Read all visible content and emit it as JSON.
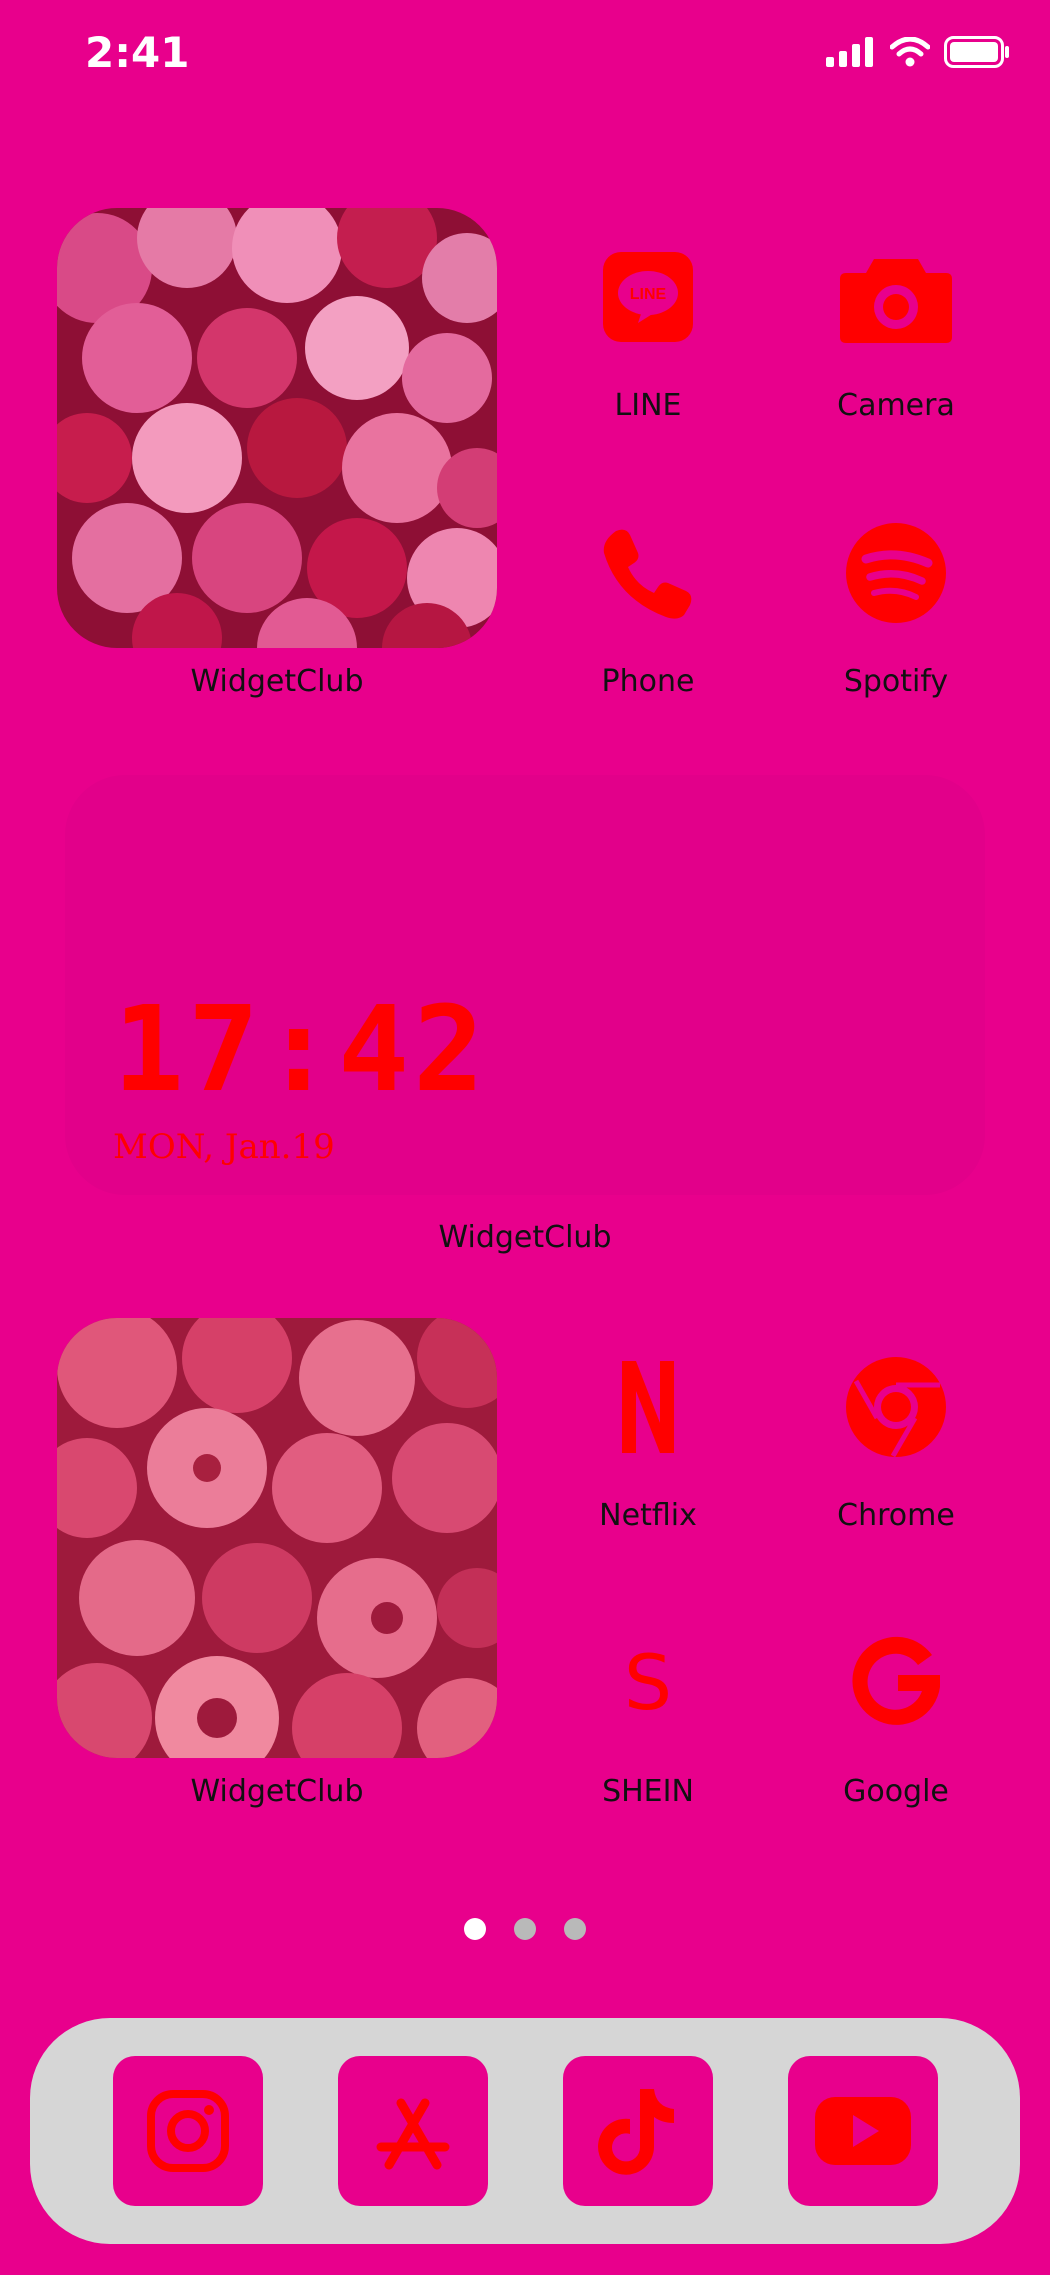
{
  "status_bar": {
    "time": "2:41"
  },
  "widgets": {
    "candy_photo": {
      "label": "WidgetClub"
    },
    "clock": {
      "time": "17:42",
      "date": "MON, Jan.19",
      "label": "WidgetClub"
    },
    "raspberry_photo": {
      "label": "WidgetClub"
    }
  },
  "apps": {
    "line": {
      "label": "LINE",
      "icon": "line-icon"
    },
    "camera": {
      "label": "Camera",
      "icon": "camera-icon"
    },
    "phone": {
      "label": "Phone",
      "icon": "phone-icon"
    },
    "spotify": {
      "label": "Spotify",
      "icon": "spotify-icon"
    },
    "netflix": {
      "label": "Netflix",
      "icon": "netflix-icon"
    },
    "chrome": {
      "label": "Chrome",
      "icon": "chrome-icon"
    },
    "shein": {
      "label": "SHEIN",
      "icon": "shein-icon"
    },
    "google": {
      "label": "Google",
      "icon": "google-icon"
    }
  },
  "dock": [
    {
      "icon": "instagram-icon"
    },
    {
      "icon": "app-store-icon"
    },
    {
      "icon": "tiktok-icon"
    },
    {
      "icon": "youtube-icon"
    }
  ],
  "page_indicator": {
    "count": 3,
    "active": 1
  },
  "colors": {
    "background": "#E8008C",
    "icon_red": "#FF0000",
    "dock": "#D6D6D6"
  }
}
